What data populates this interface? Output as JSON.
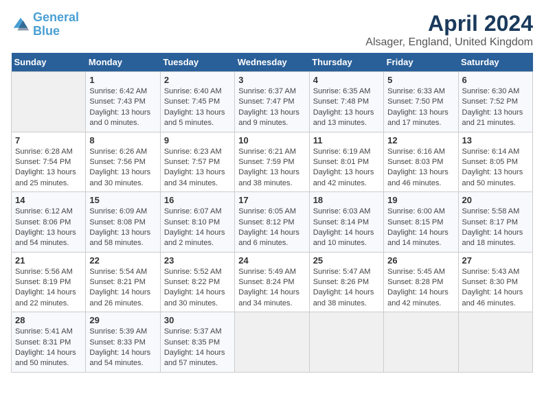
{
  "logo": {
    "line1": "General",
    "line2": "Blue"
  },
  "title": "April 2024",
  "subtitle": "Alsager, England, United Kingdom",
  "days_of_week": [
    "Sunday",
    "Monday",
    "Tuesday",
    "Wednesday",
    "Thursday",
    "Friday",
    "Saturday"
  ],
  "weeks": [
    [
      {
        "day": "",
        "sunrise": "",
        "sunset": "",
        "daylight": ""
      },
      {
        "day": "1",
        "sunrise": "Sunrise: 6:42 AM",
        "sunset": "Sunset: 7:43 PM",
        "daylight": "Daylight: 13 hours and 0 minutes."
      },
      {
        "day": "2",
        "sunrise": "Sunrise: 6:40 AM",
        "sunset": "Sunset: 7:45 PM",
        "daylight": "Daylight: 13 hours and 5 minutes."
      },
      {
        "day": "3",
        "sunrise": "Sunrise: 6:37 AM",
        "sunset": "Sunset: 7:47 PM",
        "daylight": "Daylight: 13 hours and 9 minutes."
      },
      {
        "day": "4",
        "sunrise": "Sunrise: 6:35 AM",
        "sunset": "Sunset: 7:48 PM",
        "daylight": "Daylight: 13 hours and 13 minutes."
      },
      {
        "day": "5",
        "sunrise": "Sunrise: 6:33 AM",
        "sunset": "Sunset: 7:50 PM",
        "daylight": "Daylight: 13 hours and 17 minutes."
      },
      {
        "day": "6",
        "sunrise": "Sunrise: 6:30 AM",
        "sunset": "Sunset: 7:52 PM",
        "daylight": "Daylight: 13 hours and 21 minutes."
      }
    ],
    [
      {
        "day": "7",
        "sunrise": "Sunrise: 6:28 AM",
        "sunset": "Sunset: 7:54 PM",
        "daylight": "Daylight: 13 hours and 25 minutes."
      },
      {
        "day": "8",
        "sunrise": "Sunrise: 6:26 AM",
        "sunset": "Sunset: 7:56 PM",
        "daylight": "Daylight: 13 hours and 30 minutes."
      },
      {
        "day": "9",
        "sunrise": "Sunrise: 6:23 AM",
        "sunset": "Sunset: 7:57 PM",
        "daylight": "Daylight: 13 hours and 34 minutes."
      },
      {
        "day": "10",
        "sunrise": "Sunrise: 6:21 AM",
        "sunset": "Sunset: 7:59 PM",
        "daylight": "Daylight: 13 hours and 38 minutes."
      },
      {
        "day": "11",
        "sunrise": "Sunrise: 6:19 AM",
        "sunset": "Sunset: 8:01 PM",
        "daylight": "Daylight: 13 hours and 42 minutes."
      },
      {
        "day": "12",
        "sunrise": "Sunrise: 6:16 AM",
        "sunset": "Sunset: 8:03 PM",
        "daylight": "Daylight: 13 hours and 46 minutes."
      },
      {
        "day": "13",
        "sunrise": "Sunrise: 6:14 AM",
        "sunset": "Sunset: 8:05 PM",
        "daylight": "Daylight: 13 hours and 50 minutes."
      }
    ],
    [
      {
        "day": "14",
        "sunrise": "Sunrise: 6:12 AM",
        "sunset": "Sunset: 8:06 PM",
        "daylight": "Daylight: 13 hours and 54 minutes."
      },
      {
        "day": "15",
        "sunrise": "Sunrise: 6:09 AM",
        "sunset": "Sunset: 8:08 PM",
        "daylight": "Daylight: 13 hours and 58 minutes."
      },
      {
        "day": "16",
        "sunrise": "Sunrise: 6:07 AM",
        "sunset": "Sunset: 8:10 PM",
        "daylight": "Daylight: 14 hours and 2 minutes."
      },
      {
        "day": "17",
        "sunrise": "Sunrise: 6:05 AM",
        "sunset": "Sunset: 8:12 PM",
        "daylight": "Daylight: 14 hours and 6 minutes."
      },
      {
        "day": "18",
        "sunrise": "Sunrise: 6:03 AM",
        "sunset": "Sunset: 8:14 PM",
        "daylight": "Daylight: 14 hours and 10 minutes."
      },
      {
        "day": "19",
        "sunrise": "Sunrise: 6:00 AM",
        "sunset": "Sunset: 8:15 PM",
        "daylight": "Daylight: 14 hours and 14 minutes."
      },
      {
        "day": "20",
        "sunrise": "Sunrise: 5:58 AM",
        "sunset": "Sunset: 8:17 PM",
        "daylight": "Daylight: 14 hours and 18 minutes."
      }
    ],
    [
      {
        "day": "21",
        "sunrise": "Sunrise: 5:56 AM",
        "sunset": "Sunset: 8:19 PM",
        "daylight": "Daylight: 14 hours and 22 minutes."
      },
      {
        "day": "22",
        "sunrise": "Sunrise: 5:54 AM",
        "sunset": "Sunset: 8:21 PM",
        "daylight": "Daylight: 14 hours and 26 minutes."
      },
      {
        "day": "23",
        "sunrise": "Sunrise: 5:52 AM",
        "sunset": "Sunset: 8:22 PM",
        "daylight": "Daylight: 14 hours and 30 minutes."
      },
      {
        "day": "24",
        "sunrise": "Sunrise: 5:49 AM",
        "sunset": "Sunset: 8:24 PM",
        "daylight": "Daylight: 14 hours and 34 minutes."
      },
      {
        "day": "25",
        "sunrise": "Sunrise: 5:47 AM",
        "sunset": "Sunset: 8:26 PM",
        "daylight": "Daylight: 14 hours and 38 minutes."
      },
      {
        "day": "26",
        "sunrise": "Sunrise: 5:45 AM",
        "sunset": "Sunset: 8:28 PM",
        "daylight": "Daylight: 14 hours and 42 minutes."
      },
      {
        "day": "27",
        "sunrise": "Sunrise: 5:43 AM",
        "sunset": "Sunset: 8:30 PM",
        "daylight": "Daylight: 14 hours and 46 minutes."
      }
    ],
    [
      {
        "day": "28",
        "sunrise": "Sunrise: 5:41 AM",
        "sunset": "Sunset: 8:31 PM",
        "daylight": "Daylight: 14 hours and 50 minutes."
      },
      {
        "day": "29",
        "sunrise": "Sunrise: 5:39 AM",
        "sunset": "Sunset: 8:33 PM",
        "daylight": "Daylight: 14 hours and 54 minutes."
      },
      {
        "day": "30",
        "sunrise": "Sunrise: 5:37 AM",
        "sunset": "Sunset: 8:35 PM",
        "daylight": "Daylight: 14 hours and 57 minutes."
      },
      {
        "day": "",
        "sunrise": "",
        "sunset": "",
        "daylight": ""
      },
      {
        "day": "",
        "sunrise": "",
        "sunset": "",
        "daylight": ""
      },
      {
        "day": "",
        "sunrise": "",
        "sunset": "",
        "daylight": ""
      },
      {
        "day": "",
        "sunrise": "",
        "sunset": "",
        "daylight": ""
      }
    ]
  ]
}
